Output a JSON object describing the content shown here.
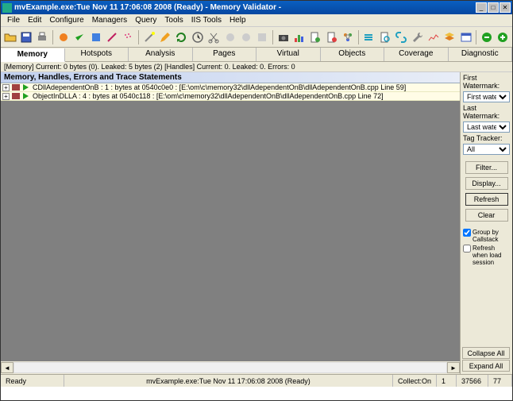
{
  "window": {
    "title": "mvExample.exe:Tue Nov 11 17:06:08 2008 (Ready) - Memory Validator -"
  },
  "menu": {
    "items": [
      "File",
      "Edit",
      "Configure",
      "Managers",
      "Query",
      "Tools",
      "IIS Tools",
      "Help"
    ]
  },
  "tabs": {
    "items": [
      "Memory",
      "Hotspots",
      "Analysis",
      "Pages",
      "Virtual",
      "Objects",
      "Coverage",
      "Diagnostic"
    ],
    "active": 0
  },
  "statusline": {
    "text": "[Memory] Current: 0 bytes (0). Leaked: 5 bytes (2) [Handles] Current: 0. Leaked: 0. Errors: 0"
  },
  "section": {
    "title": "Memory, Handles, Errors and Trace Statements"
  },
  "tree": {
    "rows": [
      "CDllAdependentOnB : 1 : bytes at 0540c0e0 : [E:\\om\\c\\memory32\\dllAdependentOnB\\dllAdependentOnB.cpp Line 59]",
      "ObjectInDLLA : 4 : bytes at 0540c118 : [E:\\om\\c\\memory32\\dllAdependentOnB\\dllAdependentOnB.cpp Line 72]"
    ]
  },
  "sidepanel": {
    "first_wm_label": "First Watermark:",
    "first_wm_value": "First watermark",
    "last_wm_label": "Last Watermark:",
    "last_wm_value": "Last watermark",
    "tag_label": "Tag Tracker:",
    "tag_value": "All",
    "filter_btn": "Filter...",
    "display_btn": "Display...",
    "refresh_btn": "Refresh",
    "clear_btn": "Clear",
    "group_chk": "Group by Callstack",
    "refresh_chk": "Refresh when load session",
    "collapse_btn": "Collapse All",
    "expand_btn": "Expand All"
  },
  "statusbar": {
    "ready": "Ready",
    "session": "mvExample.exe:Tue Nov 11 17:06:08 2008 (Ready)",
    "collect_label": "Collect:On",
    "n1": "1",
    "n2": "37566",
    "n3": "77"
  }
}
